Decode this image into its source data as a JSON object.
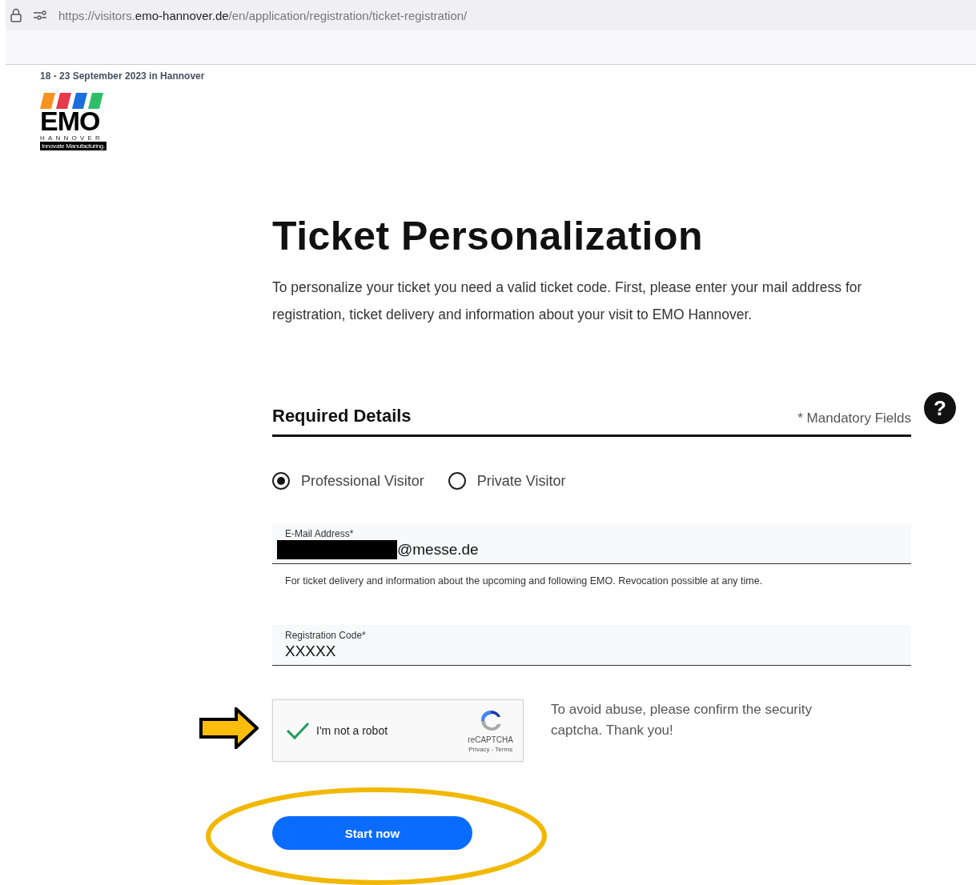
{
  "browser": {
    "url_prefix": "https://visitors.",
    "url_domain": "emo-hannover.de",
    "url_path": "/en/application/registration/ticket-registration/"
  },
  "header": {
    "date": "18 - 23 September 2023 in Hannover",
    "logo": {
      "name": "EMO",
      "sub": "HANNOVER",
      "tagline": "Innovate Manufacturing."
    }
  },
  "title": "Ticket Personalization",
  "intro": "To personalize your ticket you need a valid ticket code. First, please enter your mail address for registration, ticket delivery and information about your visit to EMO Hannover.",
  "section": {
    "title": "Required Details",
    "note": "* Mandatory Fields",
    "help": "?"
  },
  "visitor_types": [
    {
      "label": "Professional Visitor",
      "selected": true
    },
    {
      "label": "Private Visitor",
      "selected": false
    }
  ],
  "email": {
    "label": "E-Mail Address*",
    "value": "@messe.de",
    "redacted": true,
    "hint": "For ticket delivery and information about the upcoming and following EMO. Revocation possible at any time."
  },
  "registration_code": {
    "label": "Registration Code*",
    "value": "XXXXX"
  },
  "captcha": {
    "label": "I'm not a robot",
    "checked": true,
    "brand": "reCAPTCHA",
    "links": "Privacy - Terms",
    "note": "To avoid abuse, please confirm the security captcha. Thank you!"
  },
  "submit": "Start now"
}
